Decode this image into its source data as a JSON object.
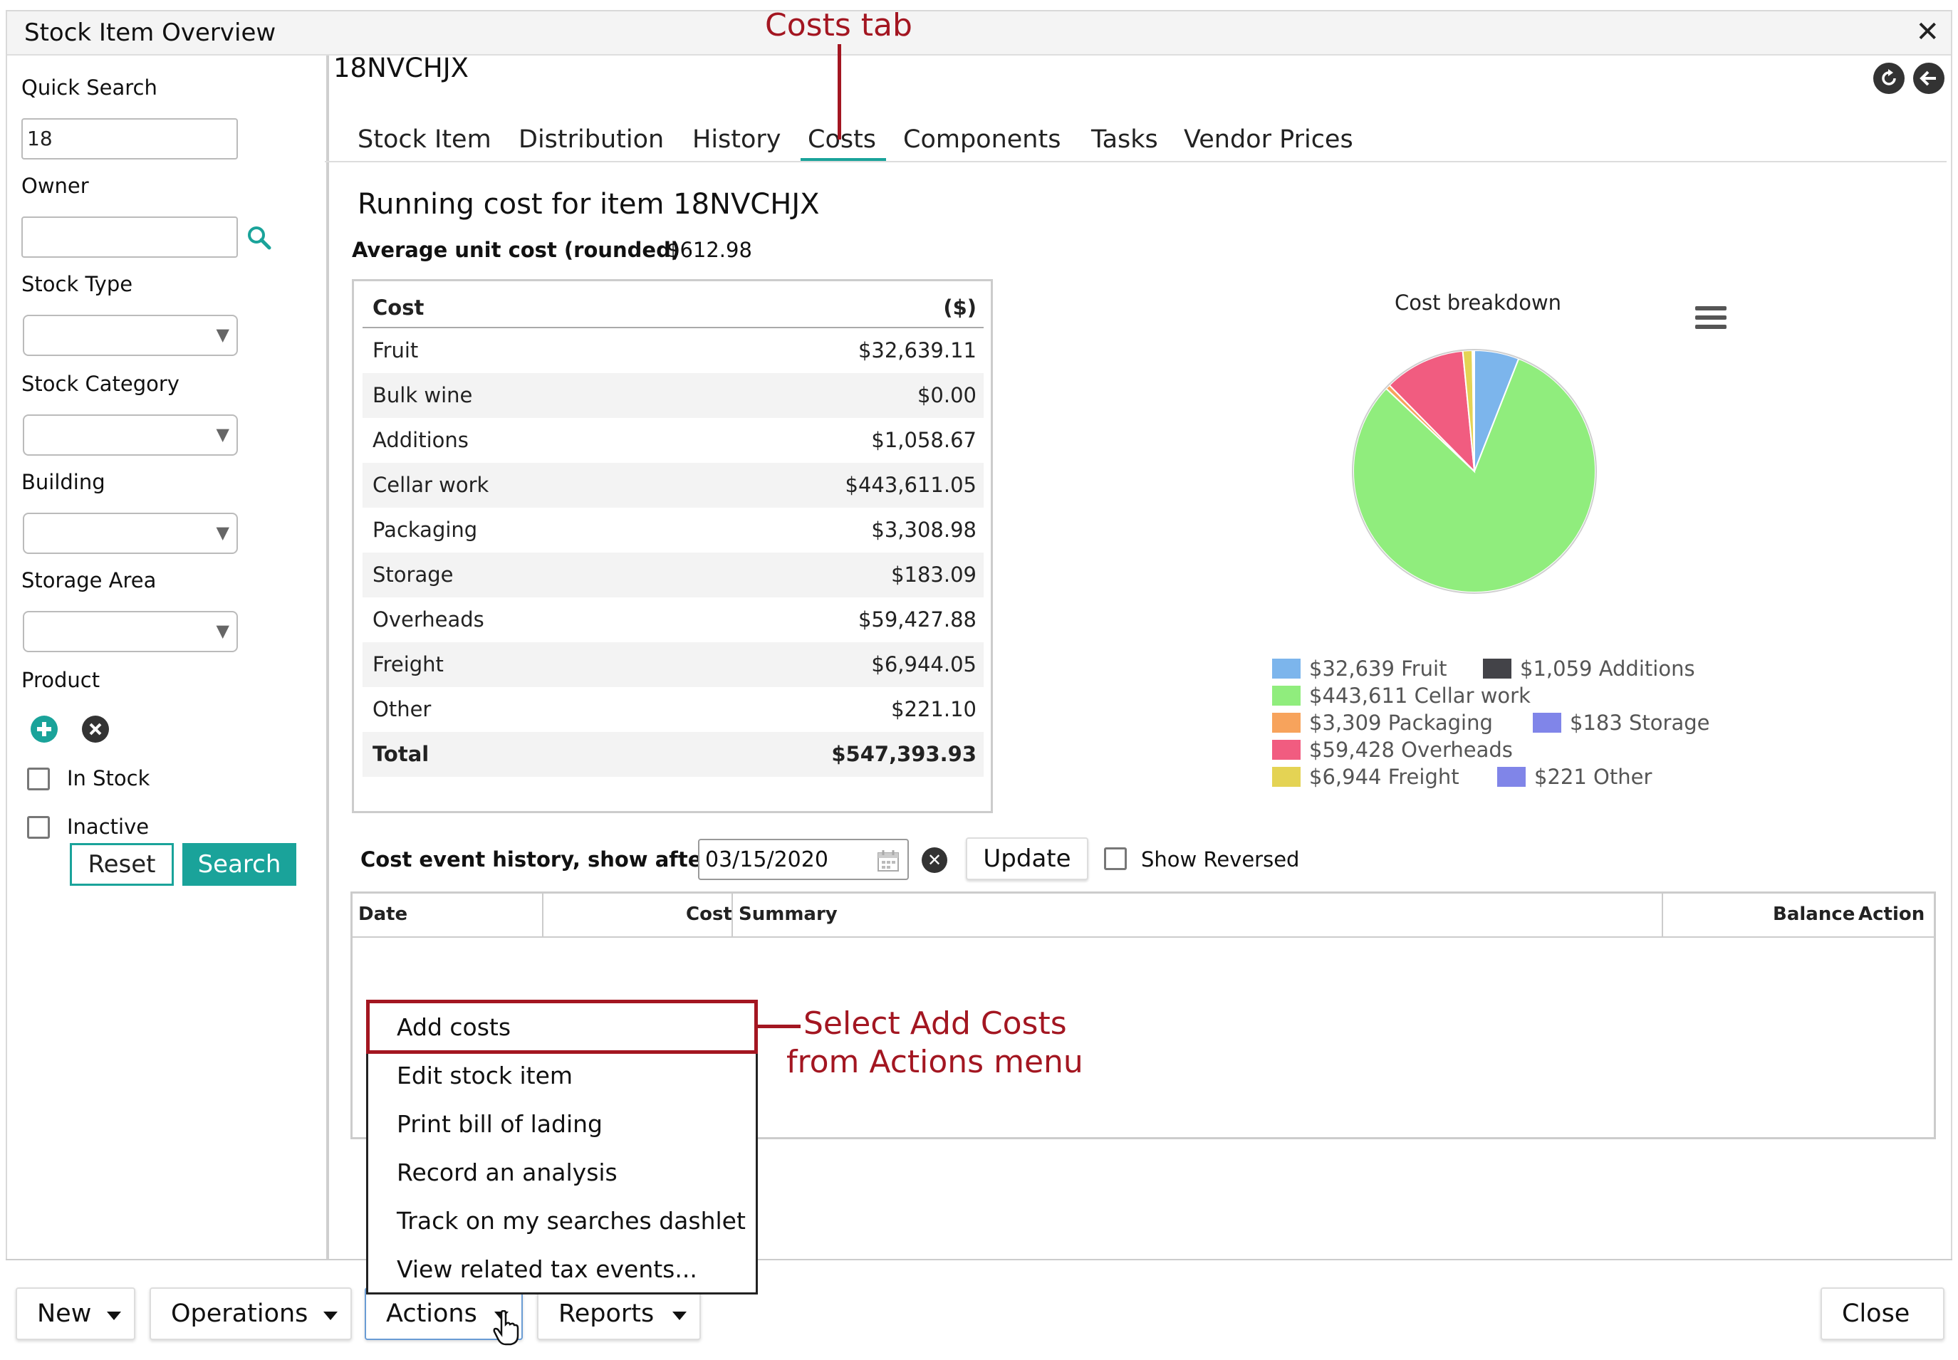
{
  "window": {
    "title": "Stock Item Overview",
    "close_glyph": "✕"
  },
  "sidebar": {
    "quick_search_label": "Quick Search",
    "quick_search_value": "18",
    "owner_label": "Owner",
    "owner_value": "",
    "stock_type_label": "Stock Type",
    "stock_category_label": "Stock Category",
    "building_label": "Building",
    "storage_area_label": "Storage Area",
    "product_label": "Product",
    "in_stock_label": "In Stock",
    "inactive_label": "Inactive",
    "reset_label": "Reset",
    "search_label": "Search"
  },
  "item": {
    "code": "18NVCHJX"
  },
  "tabs": [
    {
      "label": "Stock Item"
    },
    {
      "label": "Distribution"
    },
    {
      "label": "History"
    },
    {
      "label": "Costs",
      "active": true
    },
    {
      "label": "Components"
    },
    {
      "label": "Tasks"
    },
    {
      "label": "Vendor Prices"
    }
  ],
  "costs": {
    "heading": "Running cost for item 18NVCHJX",
    "avg_label": "Average unit cost (rounded)",
    "avg_value": "$612.98",
    "table_headers": {
      "cost": "Cost",
      "unit": "($)"
    },
    "rows": [
      {
        "label": "Fruit",
        "value": "$32,639.11"
      },
      {
        "label": "Bulk wine",
        "value": "$0.00"
      },
      {
        "label": "Additions",
        "value": "$1,058.67"
      },
      {
        "label": "Cellar work",
        "value": "$443,611.05"
      },
      {
        "label": "Packaging",
        "value": "$3,308.98"
      },
      {
        "label": "Storage",
        "value": "$183.09"
      },
      {
        "label": "Overheads",
        "value": "$59,427.88"
      },
      {
        "label": "Freight",
        "value": "$6,944.05"
      },
      {
        "label": "Other",
        "value": "$221.10"
      },
      {
        "label": "Total",
        "value": "$547,393.93"
      }
    ]
  },
  "chart_data": {
    "type": "pie",
    "title": "Cost breakdown",
    "slices": [
      {
        "label": "$32,639 Fruit",
        "value": 32639,
        "color": "#7cb5ec"
      },
      {
        "label": "$1,059 Additions",
        "value": 1059,
        "color": "#434348"
      },
      {
        "label": "$443,611 Cellar work",
        "value": 443611,
        "color": "#90ed7d"
      },
      {
        "label": "$3,309 Packaging",
        "value": 3309,
        "color": "#f7a35c"
      },
      {
        "label": "$183 Storage",
        "value": 183,
        "color": "#8085e9"
      },
      {
        "label": "$59,428 Overheads",
        "value": 59428,
        "color": "#f15c80"
      },
      {
        "label": "$6,944 Freight",
        "value": 6944,
        "color": "#e4d354"
      },
      {
        "label": "$221 Other",
        "value": 221,
        "color": "#8085e8"
      }
    ]
  },
  "history": {
    "label": "Cost event history, show after",
    "date": "03/15/2020",
    "update_label": "Update",
    "show_reversed_label": "Show Reversed",
    "columns": {
      "date": "Date",
      "cost": "Cost",
      "summary": "Summary",
      "balance": "Balance",
      "action": "Action"
    }
  },
  "actions_menu": [
    {
      "label": "Add costs"
    },
    {
      "label": "Edit stock item"
    },
    {
      "label": "Print bill of lading"
    },
    {
      "label": "Record an analysis"
    },
    {
      "label": "Track on my searches dashlet"
    },
    {
      "label": "View related tax events..."
    }
  ],
  "footer": {
    "new_label": "New",
    "operations_label": "Operations",
    "actions_label": "Actions",
    "reports_label": "Reports",
    "close_label": "Close"
  },
  "annotations": {
    "costs_tab": "Costs tab",
    "select_add_line1": "Select Add Costs",
    "select_add_line2": "from Actions menu"
  }
}
